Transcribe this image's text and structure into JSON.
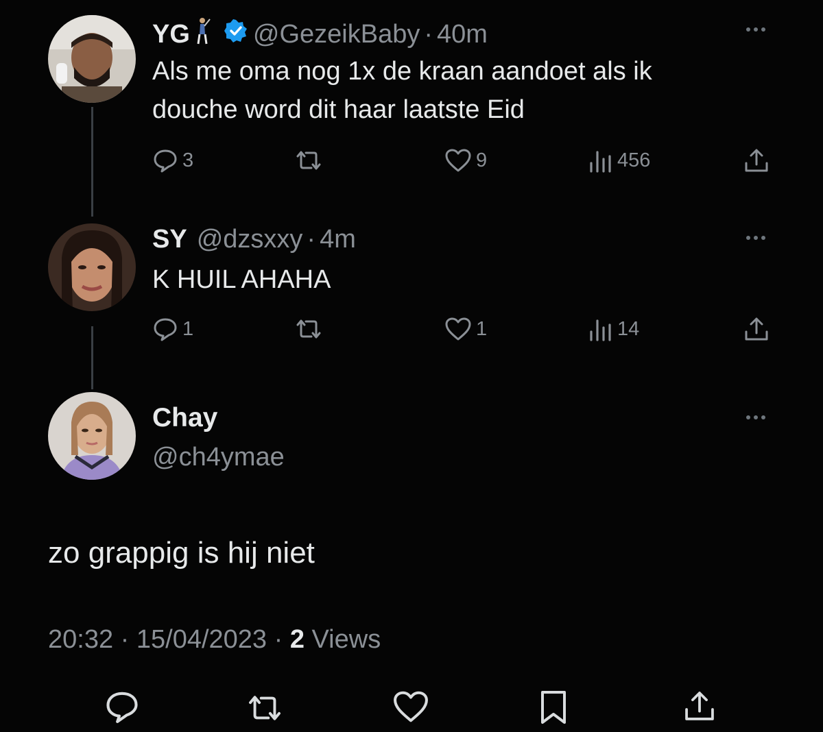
{
  "tweets": [
    {
      "name": "YG",
      "handle": "@GezeikBaby",
      "time": "40m",
      "text_lines": [
        "Als me oma nog 1x de kraan aandoet als ik",
        "douche word dit haar laatste Eid"
      ],
      "replies": "3",
      "likes": "9",
      "views": "456",
      "verified": true
    },
    {
      "name": "SY",
      "handle": "@dzsxxy",
      "time": "4m",
      "text_lines": [
        "K HUIL AHAHA"
      ],
      "replies": "1",
      "likes": "1",
      "views": "14"
    }
  ],
  "main": {
    "name": "Chay",
    "handle": "@ch4ymae",
    "text": "zo grappig is hij niet",
    "timestamp": "20:32 · 15/04/2023 · ",
    "views_count": "2",
    "views_label": " Views"
  },
  "colors": {
    "background": "#050505",
    "text": "#e7e9ea",
    "muted": "#8b9096",
    "verified": "#1d9bf0"
  },
  "icons": [
    "reply-icon",
    "retweet-icon",
    "like-icon",
    "views-icon",
    "share-icon",
    "bookmark-icon",
    "more-icon",
    "verified-badge-icon",
    "golf-emoji-icon"
  ]
}
